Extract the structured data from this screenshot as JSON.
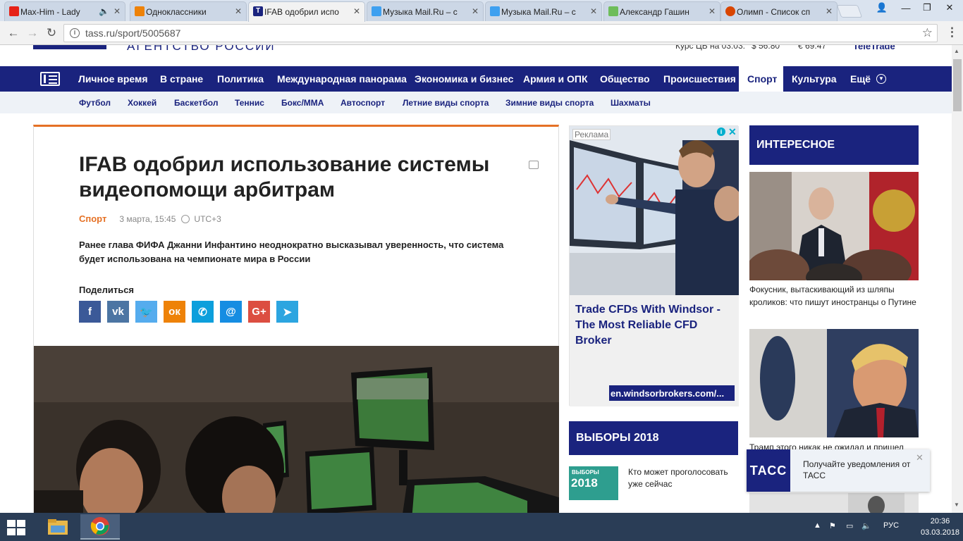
{
  "browser": {
    "tabs": [
      {
        "label": "Max-Him - Lady",
        "favicon_color": "#e62117"
      },
      {
        "label": "Одноклассники",
        "favicon_color": "#ee8208"
      },
      {
        "label": "IFAB одобрил испо",
        "favicon_color": "#1a237e",
        "active": true
      },
      {
        "label": "Музыка Mail.Ru – с",
        "favicon_color": "#3ea0f0"
      },
      {
        "label": "Музыка Mail.Ru – с",
        "favicon_color": "#3ea0f0"
      },
      {
        "label": "Александр Гашин",
        "favicon_color": "#6ebd5b"
      },
      {
        "label": "Олимп - Список сп",
        "favicon_color": "#d94500"
      }
    ],
    "url": "tass.ru/sport/5005687"
  },
  "site": {
    "agency": "АГЕНТСТВО РОССИИ",
    "rates": [
      "Курс ЦБ на 03.03:",
      "$ 56.80",
      "€ 69.47"
    ],
    "rates_brand": "TeleTrade",
    "nav": [
      "Личное время",
      "В стране",
      "Политика",
      "Международная панорама",
      "Экономика и бизнес",
      "Армия и ОПК",
      "Общество",
      "Происшествия",
      "Спорт",
      "Культура",
      "Ещё"
    ],
    "subnav": [
      "Футбол",
      "Хоккей",
      "Баскетбол",
      "Теннис",
      "Бокс/MMA",
      "Автоспорт",
      "Летние виды спорта",
      "Зимние виды спорта",
      "Шахматы"
    ]
  },
  "article": {
    "title": "IFAB одобрил использование системы видеопомощи арбитрам",
    "category": "Спорт",
    "date": "3 марта, 15:45",
    "timezone": "UTC+3",
    "lead": "Ранее глава ФИФА Джанни Инфантино неоднократно высказывал уверенность, что система будет использована на чемпионате мира в России",
    "share_label": "Поделиться",
    "share": [
      {
        "glyph": "f",
        "color": "#3b5998",
        "icon": "facebook-icon"
      },
      {
        "glyph": "vk",
        "color": "#4c75a3",
        "icon": "vk-icon"
      },
      {
        "glyph": "🐦",
        "color": "#55acee",
        "icon": "twitter-icon"
      },
      {
        "glyph": "ок",
        "color": "#ee8208",
        "icon": "odnoklassniki-icon"
      },
      {
        "glyph": "✆",
        "color": "#0c9fdc",
        "icon": "livejournal-icon"
      },
      {
        "glyph": "@",
        "color": "#168de2",
        "icon": "mailru-icon"
      },
      {
        "glyph": "G+",
        "color": "#dc4e41",
        "icon": "googleplus-icon"
      },
      {
        "glyph": "➤",
        "color": "#2ca5e0",
        "icon": "telegram-icon"
      }
    ]
  },
  "ad": {
    "label": "Реклама",
    "text": "Trade CFDs With Windsor - The Most Reliable CFD Broker",
    "url": "en.windsorbrokers.com/..."
  },
  "elections": {
    "header": "ВЫБОРЫ 2018",
    "badge_small": "ВЫБОРЫ",
    "badge_big": "2018",
    "link": "Кто может проголосовать уже сейчас"
  },
  "sidebar": {
    "header": "ИНТЕРЕСНОЕ",
    "items": [
      {
        "caption": "Фокусник, вытаскивающий из шляпы кроликов: что пишут иностранцы о Путине"
      },
      {
        "caption": "Трамп этого никак не ожидал и пришел"
      }
    ]
  },
  "notification": {
    "logo": "ТАСС",
    "text": "Получайте уведомления от ТАСС"
  },
  "taskbar": {
    "lang": "РУС",
    "time": "20:36",
    "date": "03.03.2018"
  }
}
